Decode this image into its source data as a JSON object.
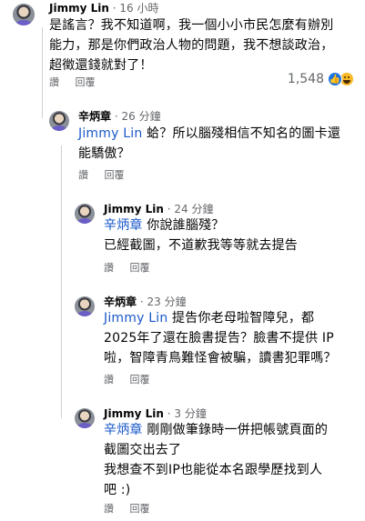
{
  "comments": [
    {
      "author": "Jimmy Lin",
      "separator": "·",
      "time": "16 小時",
      "lines": [
        "是謠言？我不知道啊，我一個小小市民怎麼有辦別",
        "能力，那是你們政治人物的問題，我不想談政治，",
        "超徵還錢就對了！"
      ],
      "like_label": "讚",
      "reply_label": "回覆",
      "reaction_count": "1,548",
      "reaction_icons": [
        "like-icon",
        "haha-icon"
      ]
    },
    {
      "author": "辛炳章",
      "separator": "·",
      "time": "26 分鐘",
      "mention": "Jimmy Lin",
      "line1_rest": " 蛤？所以腦殘相信不知名的圖卡還",
      "line2": "能驕傲？",
      "like_label": "讚",
      "reply_label": "回覆"
    },
    {
      "author": "Jimmy Lin",
      "separator": "·",
      "time": "24 分鐘",
      "mention": "辛炳章",
      "line1_rest": " 你說誰腦殘？",
      "line2": "已經截圖，不道歉我等等就去提告",
      "like_label": "讚",
      "reply_label": "回覆"
    },
    {
      "author": "辛炳章",
      "separator": "·",
      "time": "23 分鐘",
      "mention": "Jimmy Lin",
      "line1_rest": " 提告你老母啦智障兒，都",
      "line2": "2025年了還在臉書提告？臉書不提供 IP",
      "line3": "啦，智障青鳥難怪會被騙，讀書犯罪嗎？",
      "like_label": "讚",
      "reply_label": "回覆"
    },
    {
      "author": "Jimmy Lin",
      "separator": "·",
      "time": "3 分鐘",
      "mention": "辛炳章",
      "line1_rest": " 剛剛做筆錄時一併把帳號頁面的",
      "line2": "截圖交出去了",
      "line3": "我想查不到IP也能從本名跟學歷找到人",
      "line4": "吧 :)",
      "like_label": "讚",
      "reply_label": "回覆"
    }
  ],
  "colors": {
    "mention": "#1a58c9",
    "meta": "#65676b",
    "thread_line": "#ced0d4",
    "like_blue": "#1b74e4"
  }
}
